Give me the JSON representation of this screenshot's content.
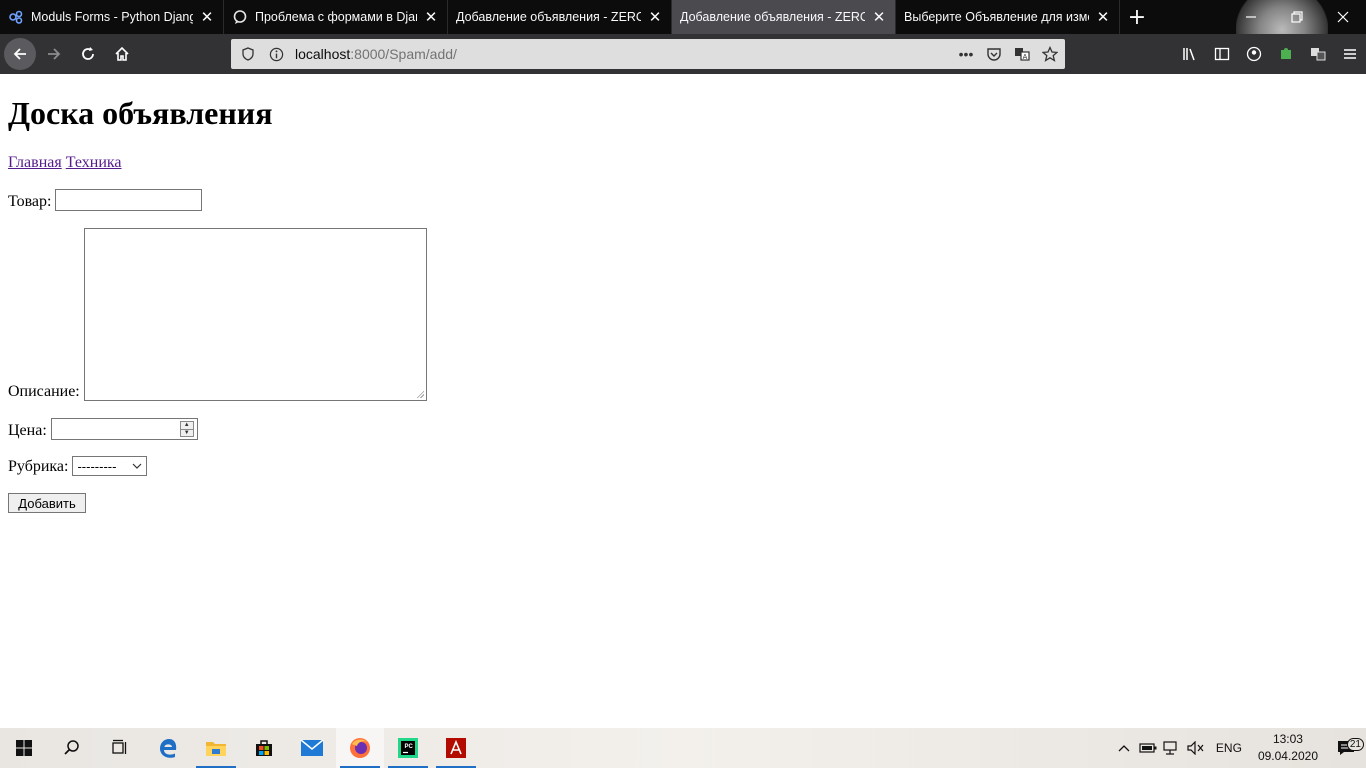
{
  "browser": {
    "tabs": [
      {
        "title": "Moduls Forms - Python Django",
        "icon": "django-logo-icon",
        "active": false
      },
      {
        "title": "Проблема с формами в Djang",
        "icon": "chat-bubble-icon",
        "active": false
      },
      {
        "title": "Добавление объявления - ZERO",
        "icon": "",
        "active": false
      },
      {
        "title": "Добавление объявления - ZERO",
        "icon": "",
        "active": true
      },
      {
        "title": "Выберите Объявление для измен",
        "icon": "",
        "active": false
      }
    ],
    "new_tab": "+",
    "url_host": "localhost",
    "url_rest": ":8000/Spam/add/"
  },
  "page": {
    "heading": "Доска объявления",
    "nav_links": [
      "Главная",
      "Техника"
    ],
    "form": {
      "product_label": "Товар:",
      "product_value": "",
      "description_label": "Описание:",
      "description_value": "",
      "price_label": "Цена:",
      "price_value": "",
      "rubric_label": "Рубрика:",
      "rubric_selected": "---------",
      "submit_label": "Добавить"
    }
  },
  "taskbar": {
    "language": "ENG",
    "time": "13:03",
    "date": "09.04.2020",
    "notification_count": "21"
  },
  "colors": {
    "tab_bar": "#0c0c0d",
    "active_tab": "#4a4a4f",
    "nav_bar": "#323234",
    "visited_link": "#551a8b",
    "taskbar_accent": "#1f6fc7"
  }
}
